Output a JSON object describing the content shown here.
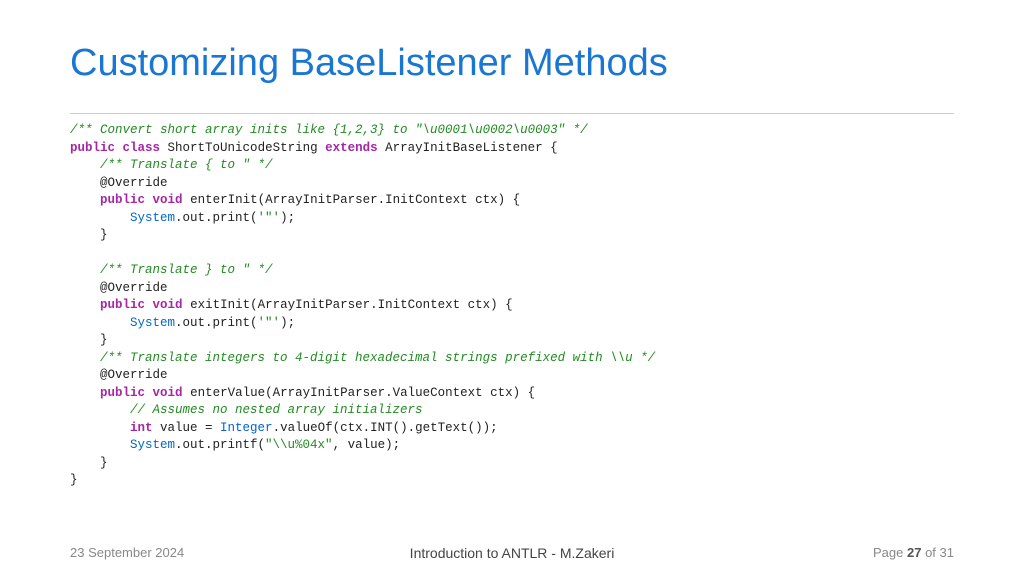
{
  "title": "Customizing BaseListener Methods",
  "code": {
    "c1": "/** Convert short array inits like {1,2,3} to \"\\u0001\\u0002\\u0003\" */",
    "kw_public": "public",
    "kw_class": "class",
    "classname": " ShortToUnicodeString ",
    "kw_extends": "extends",
    "basecls": " ArrayInitBaseListener {",
    "c2": "    /** Translate { to \" */",
    "ann1": "    @Override",
    "kw_void": "void",
    "m1_sig": " enterInit(ArrayInitParser.InitContext ctx) {",
    "sys": "System",
    "out_part": ".out.print(",
    "str_dq": "'\"'",
    "close_paren": ");",
    "brace_close": "    }",
    "c3": "    /** Translate } to \" */",
    "ann2": "    @Override",
    "m2_sig": " exitInit(ArrayInitParser.InitContext ctx) {",
    "c4": "    /** Translate integers to 4-digit hexadecimal strings prefixed with \\\\u */",
    "ann3": "    @Override",
    "m3_sig": " enterValue(ArrayInitParser.ValueContext ctx) {",
    "c5": "        // Assumes no nested array initializers",
    "kw_int": "int",
    "val_assign": " value = ",
    "integer": "Integer",
    "valueof": ".valueOf(ctx.INT().getText());",
    "printf_part": ".out.printf(",
    "fmt_str": "\"\\\\u%04x\"",
    "printf_tail": ", value);",
    "final_close": "}",
    "indent4": "    ",
    "indent8": "        "
  },
  "footer": {
    "date": "23 September 2024",
    "center": "Introduction to ANTLR - M.Zakeri",
    "page_label": "Page ",
    "page_num": "27",
    "page_total": " of 31"
  }
}
